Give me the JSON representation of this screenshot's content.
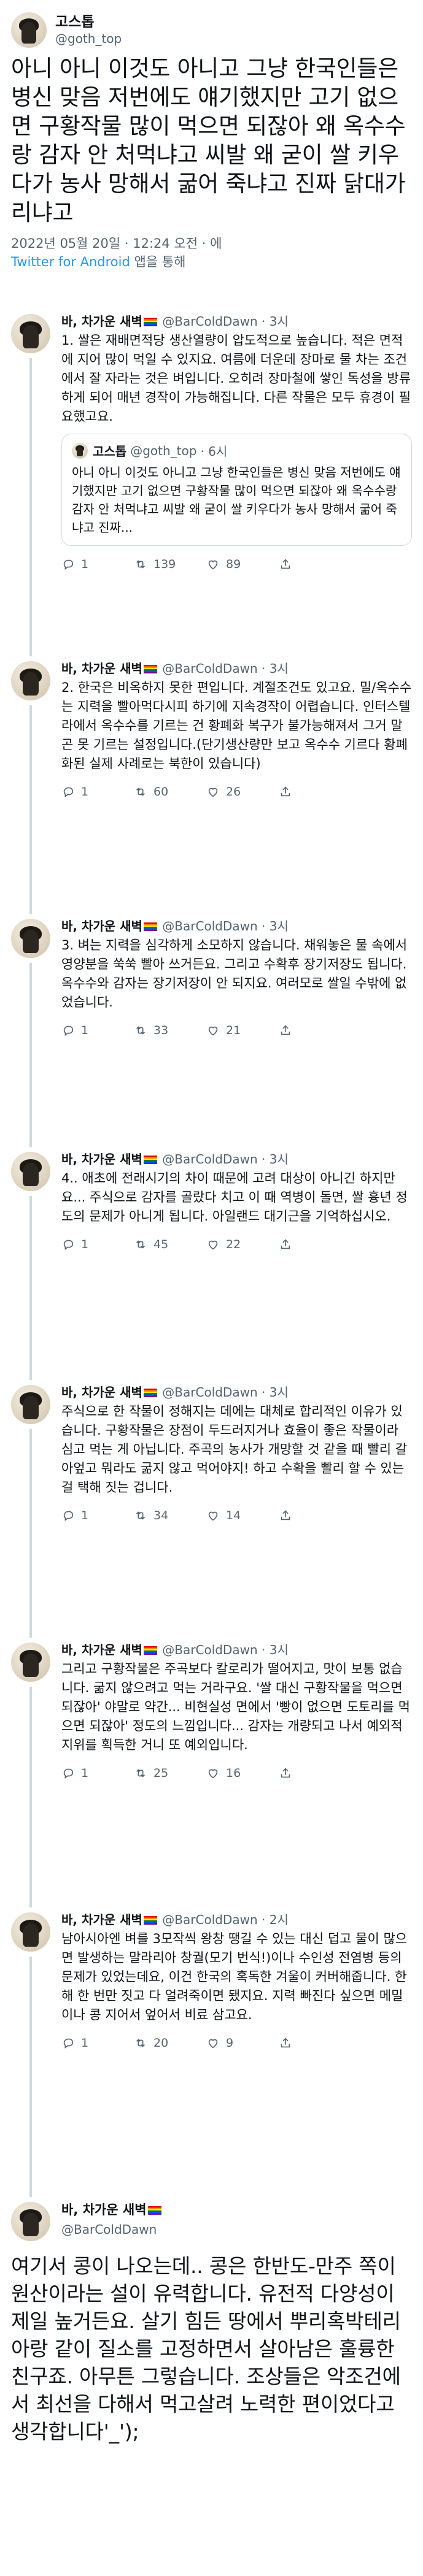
{
  "main_tweet": {
    "display_name": "고스톱",
    "handle": "@goth_top",
    "text": "아니 아니 이것도 아니고 그냥 한국인들은 병신 맞음 저번에도 얘기했지만 고기 없으면 구황작물 많이 먹으면 되잖아 왜 옥수수랑 감자 안 처먹냐고 씨발 왜 굳이 쌀 키우다가 농사 망해서 굶어 죽냐고 진짜 닭대가리냐고",
    "timestamp": "2022년 05월 20일 · 12:24 오전 · 에",
    "source_app": "Twitter for Android",
    "source_suffix": " 앱을 통해"
  },
  "replies": [
    {
      "name": "바, 차가운 새벽",
      "handle": "@BarColdDawn",
      "time": "· 3시",
      "text": "1. 쌀은 재배면적당 생산열량이 압도적으로 높습니다. 적은 면적에 지어 많이 먹일 수 있지요. 여름에 더운데 장마로 물 차는 조건에서 잘 자라는 것은 벼입니다. 오히려 장마철에 쌓인 독성을 방류하게 되어 매년 경작이 가능해집니다. 다른 작물은 모두 휴경이 필요했고요.",
      "quote": {
        "name": "고스톱",
        "handle": "@goth_top",
        "time": "· 6시",
        "text": "아니 아니 이것도 아니고 그냥 한국인들은 병신 맞음 저번에도 얘기했지만 고기 없으면 구황작물 많이 먹으면 되잖아 왜 옥수수랑 감자 안 처먹냐고 씨발 왜 굳이 쌀 키우다가 농사 망해서 굶어 죽냐고 진짜..."
      },
      "replies_count": "1",
      "retweets": "139",
      "likes": "89"
    },
    {
      "name": "바, 차가운 새벽",
      "handle": "@BarColdDawn",
      "time": "· 3시",
      "text": "2. 한국은 비옥하지 못한 편입니다. 계절조건도 있고요. 밀/옥수수는 지력을 빨아먹다시피 하기에 지속경작이 어렵습니다. 인터스텔라에서 옥수수를 기르는 건 황폐화 복구가 불가능해져서 그거 말곤 못 기르는 설정입니다.(단기생산량만 보고 옥수수 기르다 황폐화된 실제 사례로는 북한이 있습니다)",
      "quote": null,
      "replies_count": "1",
      "retweets": "60",
      "likes": "26"
    },
    {
      "name": "바, 차가운 새벽",
      "handle": "@BarColdDawn",
      "time": "· 3시",
      "text": "3. 벼는 지력을 심각하게 소모하지 않습니다. 채워놓은 물 속에서 영양분을 쑥쑥 빨아 쓰거든요. 그리고 수확후 장기저장도 됩니다. 옥수수와 감자는 장기저장이 안 되지요. 여러모로 쌀일 수밖에 없었습니다.",
      "quote": null,
      "replies_count": "1",
      "retweets": "33",
      "likes": "21"
    },
    {
      "name": "바, 차가운 새벽",
      "handle": "@BarColdDawn",
      "time": "· 3시",
      "text": "4.. 애초에 전래시기의 차이 때문에 고려 대상이 아니긴 하지만요... 주식으로 감자를 골랐다 치고 이 때 역병이 돌면, 쌀 흉년 정도의 문제가 아니게 됩니다. 아일랜드 대기근을 기억하십시오.",
      "quote": null,
      "replies_count": "1",
      "retweets": "45",
      "likes": "22"
    },
    {
      "name": "바, 차가운 새벽",
      "handle": "@BarColdDawn",
      "time": "· 3시",
      "text": "주식으로 한 작물이 정해지는 데에는 대체로 합리적인 이유가 있습니다. 구황작물은 장점이 두드러지거나 효율이 좋은 작물이라 심고 먹는 게 아닙니다. 주곡의 농사가 개망할 것 같을 때 빨리 갈아엎고 뭐라도 굶지 않고 먹어야지! 하고 수확을 빨리 할 수 있는 걸 택해 짓는 겁니다.",
      "quote": null,
      "replies_count": "1",
      "retweets": "34",
      "likes": "14"
    },
    {
      "name": "바, 차가운 새벽",
      "handle": "@BarColdDawn",
      "time": "· 3시",
      "text": "그리고 구황작물은 주곡보다 칼로리가 떨어지고, 맛이 보통 없습니다. 굶지 않으려고 먹는 거라구요. '쌀 대신 구황작물을 먹으면 되잖아' 야말로 약간... 비현실성 면에서 '빵이 없으면 도토리를 먹으면 되잖아' 정도의 느낌입니다... 감자는 개량되고 나서 예외적 지위를 획득한 거니 또 예외입니다.",
      "quote": null,
      "replies_count": "1",
      "retweets": "25",
      "likes": "16"
    },
    {
      "name": "바, 차가운 새벽",
      "handle": "@BarColdDawn",
      "time": "· 2시",
      "text": "남아시아엔 벼를 3모작씩 왕창 땡길 수 있는 대신 덥고 물이 많으면 발생하는 말라리아 창궐(모기 번식!)이나 수인성 전염병 등의 문제가 있었는데요, 이건 한국의 혹독한 겨울이 커버해줍니다. 한 해 한 번만 짓고 다 얼려죽이면 됐지요. 지력 빠진다 싶으면 메밀이나 콩 지어서 엎어서 비료 삼고요.",
      "quote": null,
      "replies_count": "1",
      "retweets": "20",
      "likes": "9"
    }
  ],
  "last_reply": {
    "name": "바, 차가운 새벽",
    "handle": "@BarColdDawn",
    "text": "여기서 콩이 나오는데.. 콩은 한반도-만주 쪽이 원산이라는 설이 유력합니다. 유전적 다양성이 제일 높거든요. 살기 힘든 땅에서 뿌리혹박테리아랑 같이 질소를 고정하면서 살아남은 훌륭한 친구죠. 아무튼 그렇습니다. 조상들은 악조건에서 최선을 다해서 먹고살려 노력한 편이었다고 생각합니다'_');"
  },
  "colors": {
    "link": "#1d9bf0",
    "secondary": "#536471",
    "thread_line": "#cfd9de"
  },
  "icons": [
    "reply-icon",
    "retweet-icon",
    "like-icon",
    "share-icon",
    "rainbow-flag-icon"
  ]
}
